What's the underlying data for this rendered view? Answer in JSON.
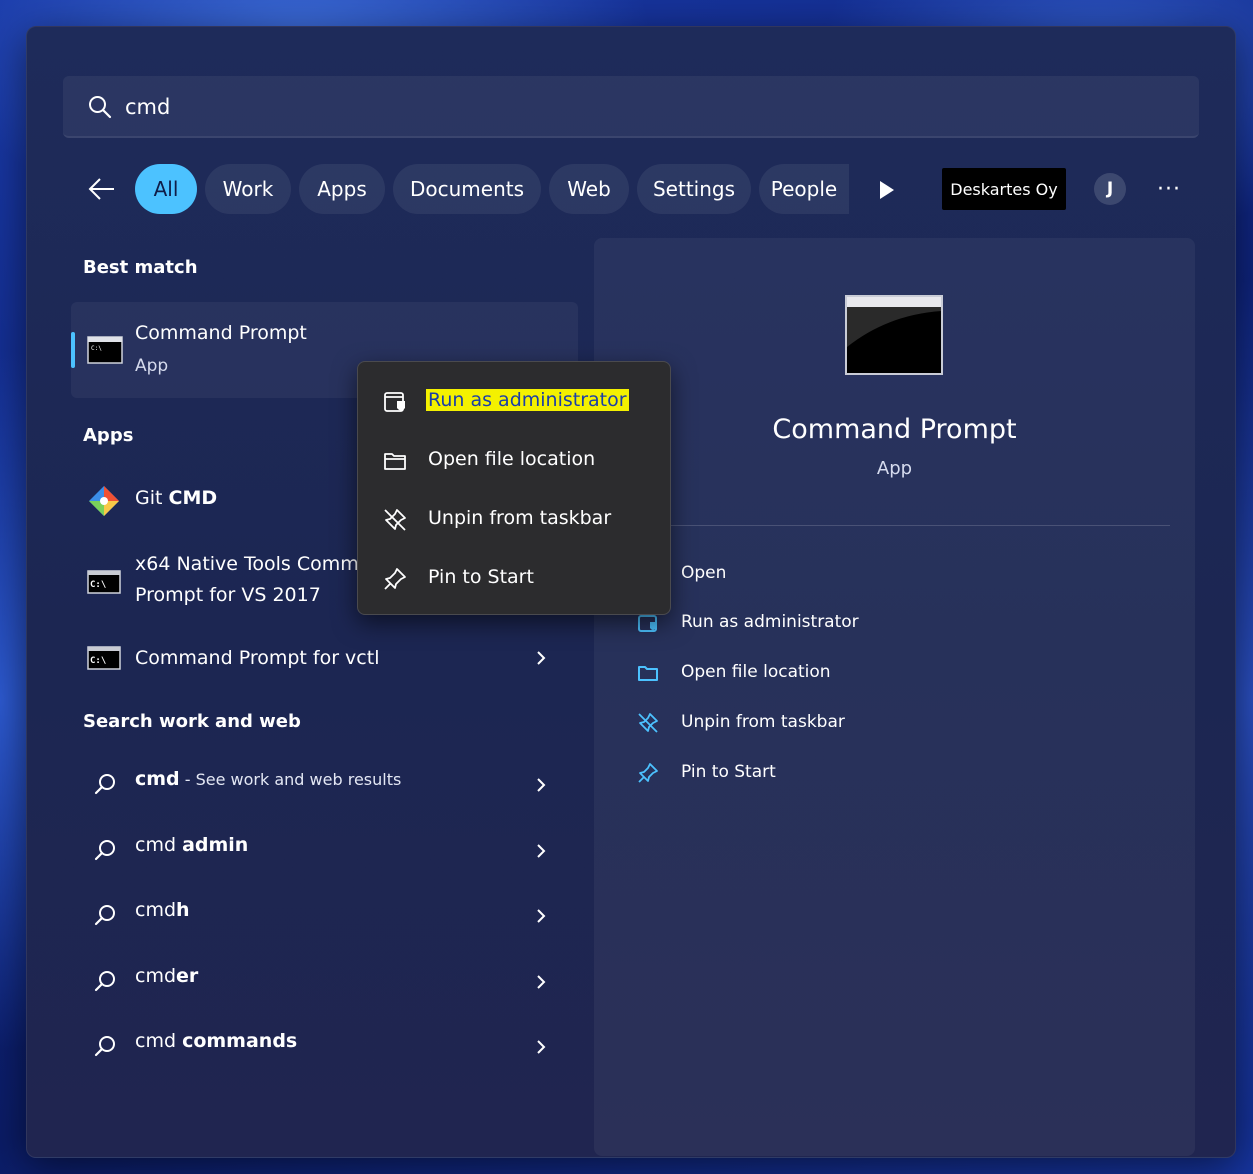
{
  "search": {
    "value": "cmd"
  },
  "filters": {
    "chips": [
      "All",
      "Work",
      "Apps",
      "Documents",
      "Web",
      "Settings",
      "People"
    ],
    "active_index": 0,
    "org_badge": "Deskartes Oy",
    "avatar_initial": "J",
    "more_label": "···"
  },
  "best_match": {
    "heading": "Best match",
    "title": "Command Prompt",
    "subtitle": "App"
  },
  "apps": {
    "heading": "Apps",
    "items": [
      {
        "label_normal": "Git ",
        "label_bold": "CMD"
      },
      {
        "line1": "x64 Native Tools Comm",
        "line2": "Prompt for VS 2017"
      },
      {
        "label": "Command Prompt for vctl"
      }
    ]
  },
  "web": {
    "heading": "Search work and web",
    "items": [
      {
        "normal": "",
        "bold": "cmd",
        "extra": " - See work and web results"
      },
      {
        "normal": "cmd ",
        "bold": "admin",
        "extra": ""
      },
      {
        "normal": "cmd",
        "bold": "h",
        "extra": ""
      },
      {
        "normal": "cmd",
        "bold": "er",
        "extra": ""
      },
      {
        "normal": "cmd ",
        "bold": "commands",
        "extra": ""
      }
    ]
  },
  "preview": {
    "title": "Command Prompt",
    "subtitle": "App",
    "actions": [
      "Open",
      "Run as administrator",
      "Open file location",
      "Unpin from taskbar",
      "Pin to Start"
    ]
  },
  "context_menu": {
    "items": [
      "Run as administrator",
      "Open file location",
      "Unpin from taskbar",
      "Pin to Start"
    ],
    "highlight_color": "#f4f100"
  },
  "colors": {
    "accent": "#4cc2ff"
  }
}
